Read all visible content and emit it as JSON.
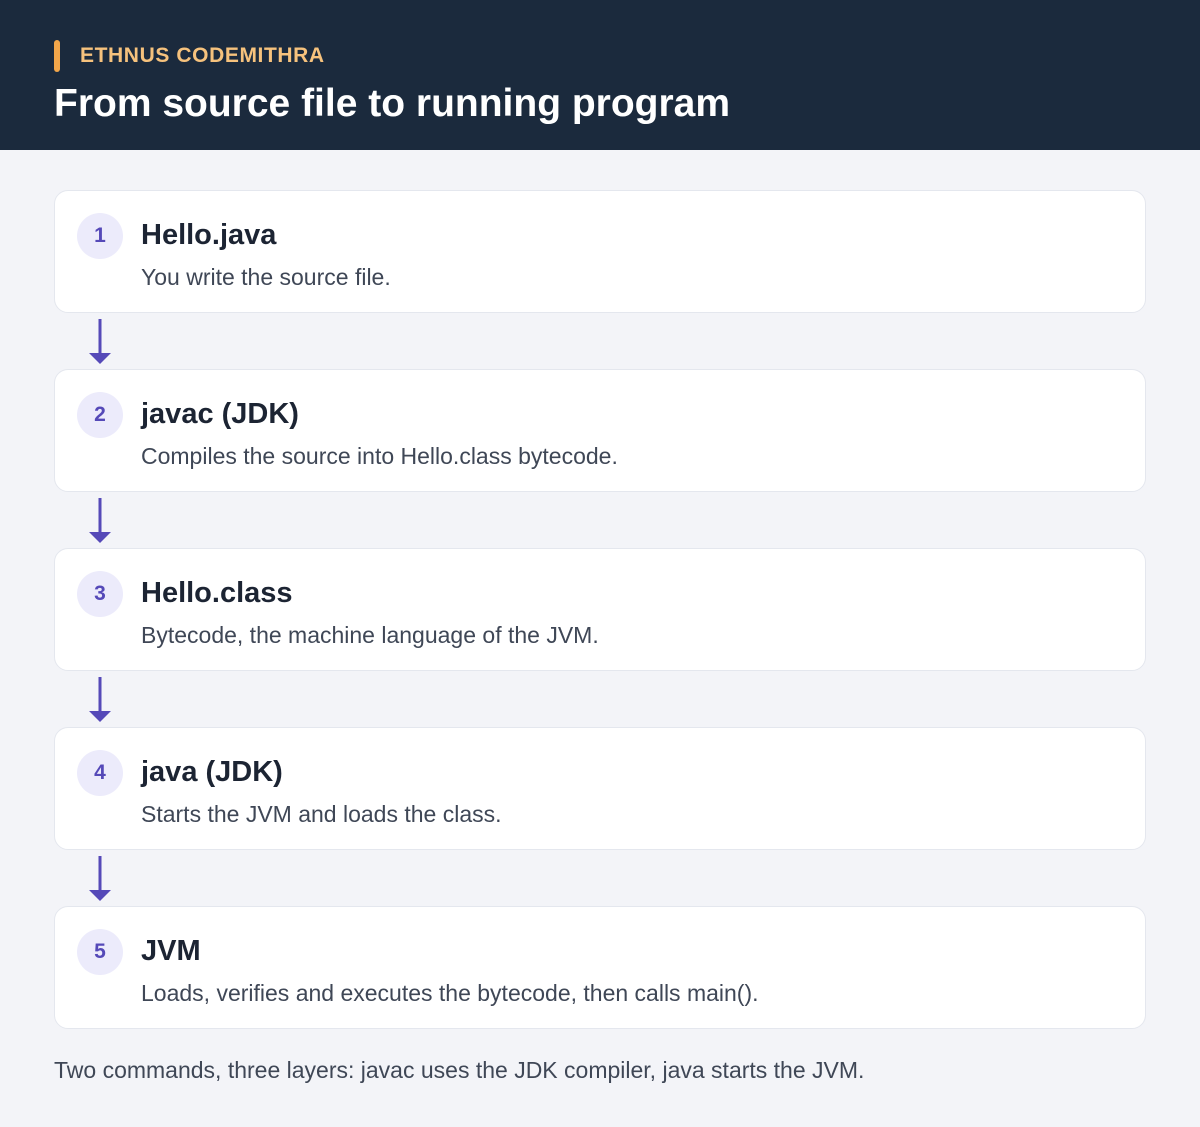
{
  "header": {
    "brand": "ETHNUS CODEMITHRA",
    "title": "From source file to running program"
  },
  "steps": [
    {
      "number": "1",
      "title": "Hello.java",
      "description": "You write the source file."
    },
    {
      "number": "2",
      "title": "javac (JDK)",
      "description": "Compiles the source into Hello.class bytecode."
    },
    {
      "number": "3",
      "title": "Hello.class",
      "description": "Bytecode, the machine language of the JVM."
    },
    {
      "number": "4",
      "title": "java (JDK)",
      "description": "Starts the JVM and loads the class."
    },
    {
      "number": "5",
      "title": "JVM",
      "description": "Loads, verifies and executes the bytecode, then calls main()."
    }
  ],
  "footer": {
    "note": "Two commands, three layers: javac uses the JDK compiler, java starts the JVM."
  },
  "colors": {
    "header_bg": "#1b2a3d",
    "brand_accent": "#f2a64a",
    "arrow": "#5549b8",
    "badge_bg": "#ecebfb"
  }
}
